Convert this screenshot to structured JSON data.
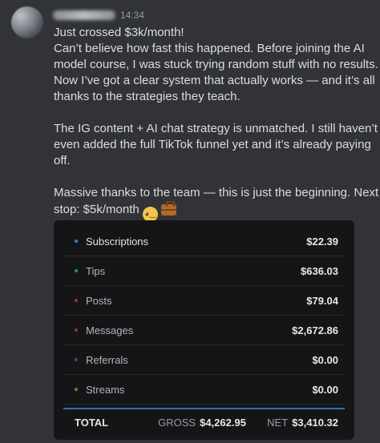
{
  "message": {
    "timestamp": "14:34",
    "lines": [
      "Just crossed $3k/month!",
      "Can’t believe how fast this happened. Before joining the AI",
      "model course, I was stuck trying random stuff with no results.",
      "Now I’ve got a clear system that actually works — and it’s all",
      "thanks to the strategies they teach.",
      "The IG content + AI chat strategy is unmatched. I still haven’t",
      "even added the full TikTok funnel yet and it’s already paying",
      "off.",
      "Massive thanks to the team — this is just the beginning. Next",
      "stop: $5k/month"
    ],
    "emojis": [
      "face-with-hand-over-mouth-emoji",
      "briefcase-emoji"
    ]
  },
  "earnings": {
    "rows": [
      {
        "label": "Subscriptions",
        "value": "$22.39",
        "dot_color": "#3b82c4"
      },
      {
        "label": "Tips",
        "value": "$636.03",
        "dot_color": "#2f8f78"
      },
      {
        "label": "Posts",
        "value": "$79.04",
        "dot_color": "#8a3a4a"
      },
      {
        "label": "Messages",
        "value": "$2,672.86",
        "dot_color": "#8a3a3a"
      },
      {
        "label": "Referrals",
        "value": "$0.00",
        "dot_color": "#4a4a7a"
      },
      {
        "label": "Streams",
        "value": "$0.00",
        "dot_color": "#a0682a"
      }
    ],
    "total_label": "TOTAL",
    "gross_label": "GROSS",
    "gross_value": "$4,262.95",
    "net_label": "NET",
    "net_value": "$3,410.32",
    "divider_color": "#2f6fae"
  }
}
